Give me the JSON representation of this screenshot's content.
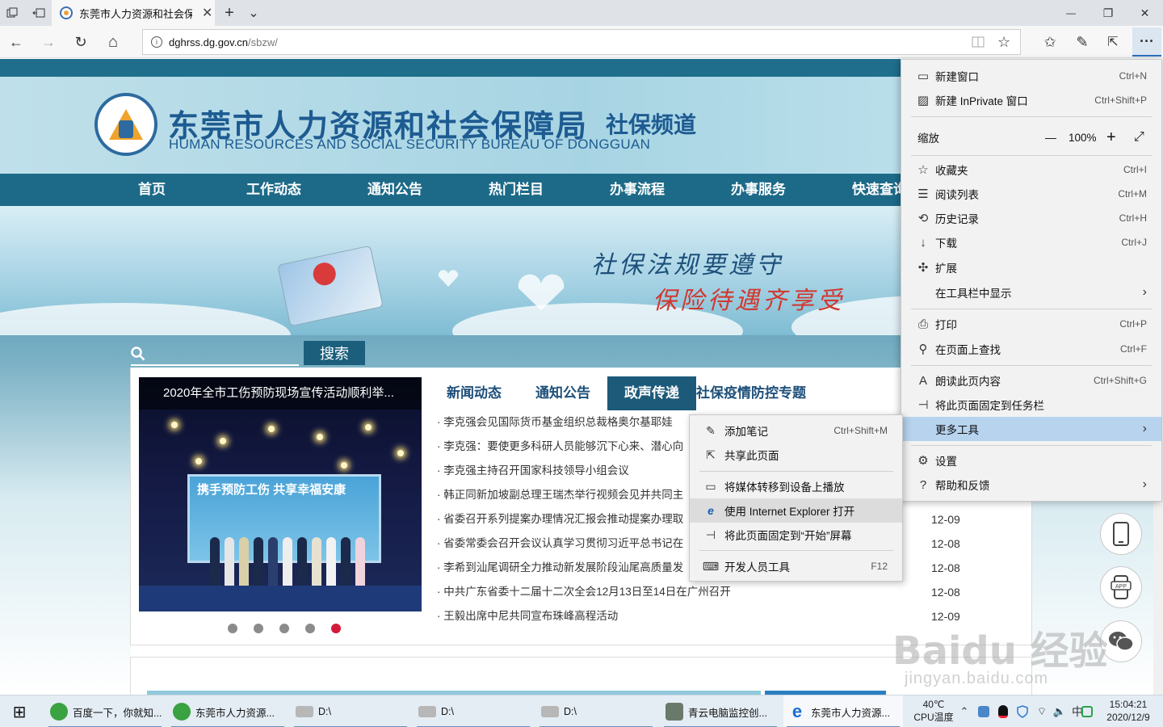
{
  "browser": {
    "tab_title": "东莞市人力资源和社会保",
    "url_host": "dghrss.dg.gov.cn",
    "url_path": "/sbzw/",
    "new_tab_glyph": "+",
    "tab_list_glyph": "⌄",
    "min_glyph": "—",
    "restore_glyph": "❐",
    "close_glyph": "✕",
    "back_glyph": "←",
    "forward_glyph": "→",
    "refresh_glyph": "↻",
    "home_glyph": "⌂",
    "info_glyph": "i",
    "more_glyph": "···",
    "tab_close_glyph": "✕"
  },
  "site": {
    "title": "东莞市人力资源和社会保障局",
    "channel": "社保频道",
    "title_en": "HUMAN RESOURCES AND SOCIAL SECURITY BUREAU OF DONGGUAN",
    "nav": [
      "首页",
      "工作动态",
      "通知公告",
      "热门栏目",
      "办事流程",
      "办事服务",
      "快速查询"
    ],
    "slogan_line1": "社保法规要遵守",
    "slogan_line2": "保险待遇齐享受",
    "search_button": "搜索",
    "slide_caption": "2020年全市工伤预防现场宣传活动顺利举...",
    "slide_stage_text": "携手预防工伤 共享幸福安康",
    "news_tabs": [
      "新闻动态",
      "通知公告",
      "政声传递",
      "社保疫情防控专题"
    ],
    "active_news_tab": "政声传递",
    "news_items": [
      {
        "title": "· 李克强会见国际货币基金组织总裁格奥尔基耶娃",
        "date": ""
      },
      {
        "title": "· 李克强：要使更多科研人员能够沉下心来、潜心向",
        "date": ""
      },
      {
        "title": "· 李克强主持召开国家科技领导小组会议",
        "date": ""
      },
      {
        "title": "· 韩正同新加坡副总理王瑞杰举行视频会见并共同主",
        "date": ""
      },
      {
        "title": "· 省委召开系列提案办理情况汇报会推动提案办理取",
        "date": "12-09"
      },
      {
        "title": "· 省委常委会召开会议认真学习贯彻习近平总书记在",
        "date": "12-08"
      },
      {
        "title": "· 李希到汕尾调研全力推动新发展阶段汕尾高质量发",
        "date": "12-08"
      },
      {
        "title": "· 中共广东省委十二届十二次全会12月13日至14日在广州召开",
        "date": "12-08"
      },
      {
        "title": "· 王毅出席中尼共同宣布珠峰高程活动",
        "date": "12-09"
      }
    ],
    "slide_dots_count": 5,
    "active_dot": 5,
    "watermark": "Baidu 经验",
    "watermark_url": "jingyan.baidu.com"
  },
  "menu": {
    "items": [
      {
        "label": "新建窗口",
        "shortcut": "Ctrl+N",
        "icon": "new-window-icon",
        "glyph": "▭"
      },
      {
        "label": "新建 InPrivate 窗口",
        "shortcut": "Ctrl+Shift+P",
        "icon": "inprivate-icon",
        "glyph": "▨"
      },
      {
        "label": "缩放",
        "zoom_value": "100%",
        "zoom_minus": "—",
        "zoom_plus": "+",
        "fullscreen": "⤢"
      },
      {
        "label": "收藏夹",
        "shortcut": "Ctrl+I",
        "icon": "favorites-icon",
        "glyph": "☆"
      },
      {
        "label": "阅读列表",
        "shortcut": "Ctrl+M",
        "icon": "reading-list-icon",
        "glyph": "☰"
      },
      {
        "label": "历史记录",
        "shortcut": "Ctrl+H",
        "icon": "history-icon",
        "glyph": "⟲"
      },
      {
        "label": "下载",
        "shortcut": "Ctrl+J",
        "icon": "download-icon",
        "glyph": "↓"
      },
      {
        "label": "扩展",
        "shortcut": "",
        "icon": "extensions-icon",
        "glyph": "✣"
      },
      {
        "label": "在工具栏中显示",
        "shortcut": "",
        "icon": "",
        "glyph": ""
      },
      {
        "label": "打印",
        "shortcut": "Ctrl+P",
        "icon": "print-icon",
        "glyph": "⎙"
      },
      {
        "label": "在页面上查找",
        "shortcut": "Ctrl+F",
        "icon": "find-icon",
        "glyph": "⚲"
      },
      {
        "label": "朗读此页内容",
        "shortcut": "Ctrl+Shift+G",
        "icon": "read-aloud-icon",
        "glyph": "A"
      },
      {
        "label": "将此页面固定到任务栏",
        "shortcut": "",
        "icon": "pin-icon",
        "glyph": "⊣"
      },
      {
        "label": "更多工具",
        "shortcut": "",
        "icon": "",
        "glyph": ""
      },
      {
        "label": "设置",
        "shortcut": "",
        "icon": "settings-icon",
        "glyph": "⚙"
      },
      {
        "label": "帮助和反馈",
        "shortcut": "",
        "icon": "help-icon",
        "glyph": "?"
      }
    ],
    "chevron_glyph": "›"
  },
  "submenu": {
    "items": [
      {
        "label": "添加笔记",
        "shortcut": "Ctrl+Shift+M",
        "icon": "pen-icon",
        "glyph": "✎"
      },
      {
        "label": "共享此页面",
        "shortcut": "",
        "icon": "share-icon",
        "glyph": "⇱"
      },
      {
        "label": "将媒体转移到设备上播放",
        "shortcut": "",
        "icon": "cast-icon",
        "glyph": "▭"
      },
      {
        "label": "使用 Internet Explorer 打开",
        "shortcut": "",
        "icon": "ie-icon",
        "glyph": "e"
      },
      {
        "label": "将此页面固定到“开始”屏幕",
        "shortcut": "",
        "icon": "pin-start-icon",
        "glyph": "⊣"
      },
      {
        "label": "开发人员工具",
        "shortcut": "F12",
        "icon": "devtools-icon",
        "glyph": "⌨"
      }
    ]
  },
  "taskbar": {
    "items": [
      {
        "label": "百度一下，你就知...",
        "icon": "browser-360-icon"
      },
      {
        "label": "东莞市人力资源...",
        "icon": "browser-360-icon"
      },
      {
        "label": "D:\\",
        "icon": "drive-icon"
      },
      {
        "label": "D:\\",
        "icon": "drive-icon"
      },
      {
        "label": "D:\\",
        "icon": "drive-icon"
      },
      {
        "label": "青云电脑监控创...",
        "icon": "app-icon"
      },
      {
        "label": "东莞市人力资源...",
        "icon": "edge-icon"
      }
    ],
    "cpu_temp": "40℃",
    "cpu_label": "CPU温度",
    "time": "15:04:21",
    "date": "2020/12/9",
    "start_glyph": "⊞",
    "tray_up_glyph": "⌃",
    "volume_glyph": "🔈",
    "network_glyph": "⌔",
    "ime_glyph": "中"
  },
  "colors": {
    "nav_bg": "#1d6a88",
    "brand_blue": "#1d5b91",
    "menu_highlight": "#b7d3ee",
    "active_dot": "#d6193a"
  }
}
